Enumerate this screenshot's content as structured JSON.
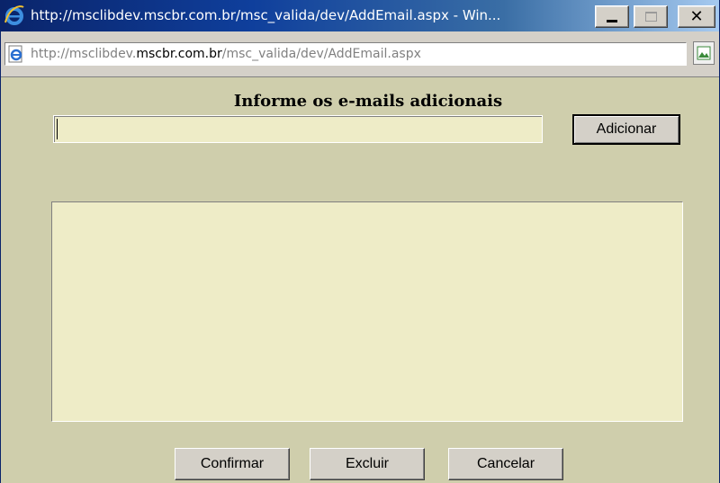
{
  "window": {
    "title": "http://msclibdev.mscbr.com.br/msc_valida/dev/AddEmail.aspx - Win..."
  },
  "address": {
    "prefix": "http://msclibdev.",
    "domain": "mscbr.com.br",
    "path": "/msc_valida/dev/AddEmail.aspx"
  },
  "form": {
    "heading": "Informe os e-mails adicionais",
    "email_value": "",
    "add_label": "Adicionar",
    "confirm_label": "Confirmar",
    "delete_label": "Excluir",
    "cancel_label": "Cancelar",
    "list_items": []
  },
  "icons": {
    "app": "internet-explorer-icon",
    "page": "ie-page-icon",
    "side": "picture-icon"
  },
  "colors": {
    "content_bg": "#cfceac",
    "field_bg": "#eeecc7",
    "button_face": "#d4d0c8",
    "titlebar_start": "#0a246a"
  }
}
